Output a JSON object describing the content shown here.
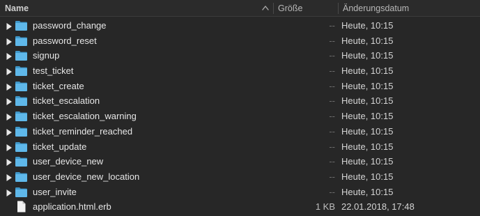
{
  "columns": {
    "name": "Name",
    "size": "Größe",
    "date": "Änderungsdatum"
  },
  "colors": {
    "background": "#272727",
    "folder": "#5fb8ea",
    "file": "#f2f2f2"
  },
  "rows": [
    {
      "name": "password_change",
      "size": "--",
      "date": "Heute, 10:15",
      "type": "folder"
    },
    {
      "name": "password_reset",
      "size": "--",
      "date": "Heute, 10:15",
      "type": "folder"
    },
    {
      "name": "signup",
      "size": "--",
      "date": "Heute, 10:15",
      "type": "folder"
    },
    {
      "name": "test_ticket",
      "size": "--",
      "date": "Heute, 10:15",
      "type": "folder"
    },
    {
      "name": "ticket_create",
      "size": "--",
      "date": "Heute, 10:15",
      "type": "folder"
    },
    {
      "name": "ticket_escalation",
      "size": "--",
      "date": "Heute, 10:15",
      "type": "folder"
    },
    {
      "name": "ticket_escalation_warning",
      "size": "--",
      "date": "Heute, 10:15",
      "type": "folder"
    },
    {
      "name": "ticket_reminder_reached",
      "size": "--",
      "date": "Heute, 10:15",
      "type": "folder"
    },
    {
      "name": "ticket_update",
      "size": "--",
      "date": "Heute, 10:15",
      "type": "folder"
    },
    {
      "name": "user_device_new",
      "size": "--",
      "date": "Heute, 10:15",
      "type": "folder"
    },
    {
      "name": "user_device_new_location",
      "size": "--",
      "date": "Heute, 10:15",
      "type": "folder"
    },
    {
      "name": "user_invite",
      "size": "--",
      "date": "Heute, 10:15",
      "type": "folder"
    },
    {
      "name": "application.html.erb",
      "size": "1 KB",
      "date": "22.01.2018, 17:48",
      "type": "file"
    }
  ]
}
